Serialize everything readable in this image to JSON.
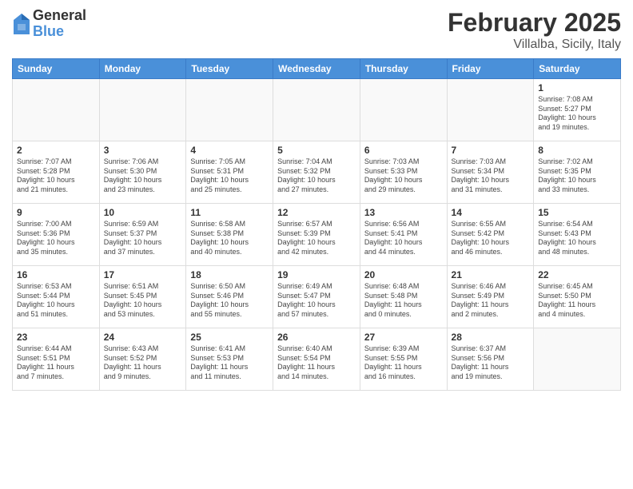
{
  "logo": {
    "general": "General",
    "blue": "Blue"
  },
  "header": {
    "title": "February 2025",
    "location": "Villalba, Sicily, Italy"
  },
  "days_of_week": [
    "Sunday",
    "Monday",
    "Tuesday",
    "Wednesday",
    "Thursday",
    "Friday",
    "Saturday"
  ],
  "weeks": [
    [
      {
        "day": "",
        "info": ""
      },
      {
        "day": "",
        "info": ""
      },
      {
        "day": "",
        "info": ""
      },
      {
        "day": "",
        "info": ""
      },
      {
        "day": "",
        "info": ""
      },
      {
        "day": "",
        "info": ""
      },
      {
        "day": "1",
        "info": "Sunrise: 7:08 AM\nSunset: 5:27 PM\nDaylight: 10 hours\nand 19 minutes."
      }
    ],
    [
      {
        "day": "2",
        "info": "Sunrise: 7:07 AM\nSunset: 5:28 PM\nDaylight: 10 hours\nand 21 minutes."
      },
      {
        "day": "3",
        "info": "Sunrise: 7:06 AM\nSunset: 5:30 PM\nDaylight: 10 hours\nand 23 minutes."
      },
      {
        "day": "4",
        "info": "Sunrise: 7:05 AM\nSunset: 5:31 PM\nDaylight: 10 hours\nand 25 minutes."
      },
      {
        "day": "5",
        "info": "Sunrise: 7:04 AM\nSunset: 5:32 PM\nDaylight: 10 hours\nand 27 minutes."
      },
      {
        "day": "6",
        "info": "Sunrise: 7:03 AM\nSunset: 5:33 PM\nDaylight: 10 hours\nand 29 minutes."
      },
      {
        "day": "7",
        "info": "Sunrise: 7:03 AM\nSunset: 5:34 PM\nDaylight: 10 hours\nand 31 minutes."
      },
      {
        "day": "8",
        "info": "Sunrise: 7:02 AM\nSunset: 5:35 PM\nDaylight: 10 hours\nand 33 minutes."
      }
    ],
    [
      {
        "day": "9",
        "info": "Sunrise: 7:00 AM\nSunset: 5:36 PM\nDaylight: 10 hours\nand 35 minutes."
      },
      {
        "day": "10",
        "info": "Sunrise: 6:59 AM\nSunset: 5:37 PM\nDaylight: 10 hours\nand 37 minutes."
      },
      {
        "day": "11",
        "info": "Sunrise: 6:58 AM\nSunset: 5:38 PM\nDaylight: 10 hours\nand 40 minutes."
      },
      {
        "day": "12",
        "info": "Sunrise: 6:57 AM\nSunset: 5:39 PM\nDaylight: 10 hours\nand 42 minutes."
      },
      {
        "day": "13",
        "info": "Sunrise: 6:56 AM\nSunset: 5:41 PM\nDaylight: 10 hours\nand 44 minutes."
      },
      {
        "day": "14",
        "info": "Sunrise: 6:55 AM\nSunset: 5:42 PM\nDaylight: 10 hours\nand 46 minutes."
      },
      {
        "day": "15",
        "info": "Sunrise: 6:54 AM\nSunset: 5:43 PM\nDaylight: 10 hours\nand 48 minutes."
      }
    ],
    [
      {
        "day": "16",
        "info": "Sunrise: 6:53 AM\nSunset: 5:44 PM\nDaylight: 10 hours\nand 51 minutes."
      },
      {
        "day": "17",
        "info": "Sunrise: 6:51 AM\nSunset: 5:45 PM\nDaylight: 10 hours\nand 53 minutes."
      },
      {
        "day": "18",
        "info": "Sunrise: 6:50 AM\nSunset: 5:46 PM\nDaylight: 10 hours\nand 55 minutes."
      },
      {
        "day": "19",
        "info": "Sunrise: 6:49 AM\nSunset: 5:47 PM\nDaylight: 10 hours\nand 57 minutes."
      },
      {
        "day": "20",
        "info": "Sunrise: 6:48 AM\nSunset: 5:48 PM\nDaylight: 11 hours\nand 0 minutes."
      },
      {
        "day": "21",
        "info": "Sunrise: 6:46 AM\nSunset: 5:49 PM\nDaylight: 11 hours\nand 2 minutes."
      },
      {
        "day": "22",
        "info": "Sunrise: 6:45 AM\nSunset: 5:50 PM\nDaylight: 11 hours\nand 4 minutes."
      }
    ],
    [
      {
        "day": "23",
        "info": "Sunrise: 6:44 AM\nSunset: 5:51 PM\nDaylight: 11 hours\nand 7 minutes."
      },
      {
        "day": "24",
        "info": "Sunrise: 6:43 AM\nSunset: 5:52 PM\nDaylight: 11 hours\nand 9 minutes."
      },
      {
        "day": "25",
        "info": "Sunrise: 6:41 AM\nSunset: 5:53 PM\nDaylight: 11 hours\nand 11 minutes."
      },
      {
        "day": "26",
        "info": "Sunrise: 6:40 AM\nSunset: 5:54 PM\nDaylight: 11 hours\nand 14 minutes."
      },
      {
        "day": "27",
        "info": "Sunrise: 6:39 AM\nSunset: 5:55 PM\nDaylight: 11 hours\nand 16 minutes."
      },
      {
        "day": "28",
        "info": "Sunrise: 6:37 AM\nSunset: 5:56 PM\nDaylight: 11 hours\nand 19 minutes."
      },
      {
        "day": "",
        "info": ""
      }
    ]
  ]
}
